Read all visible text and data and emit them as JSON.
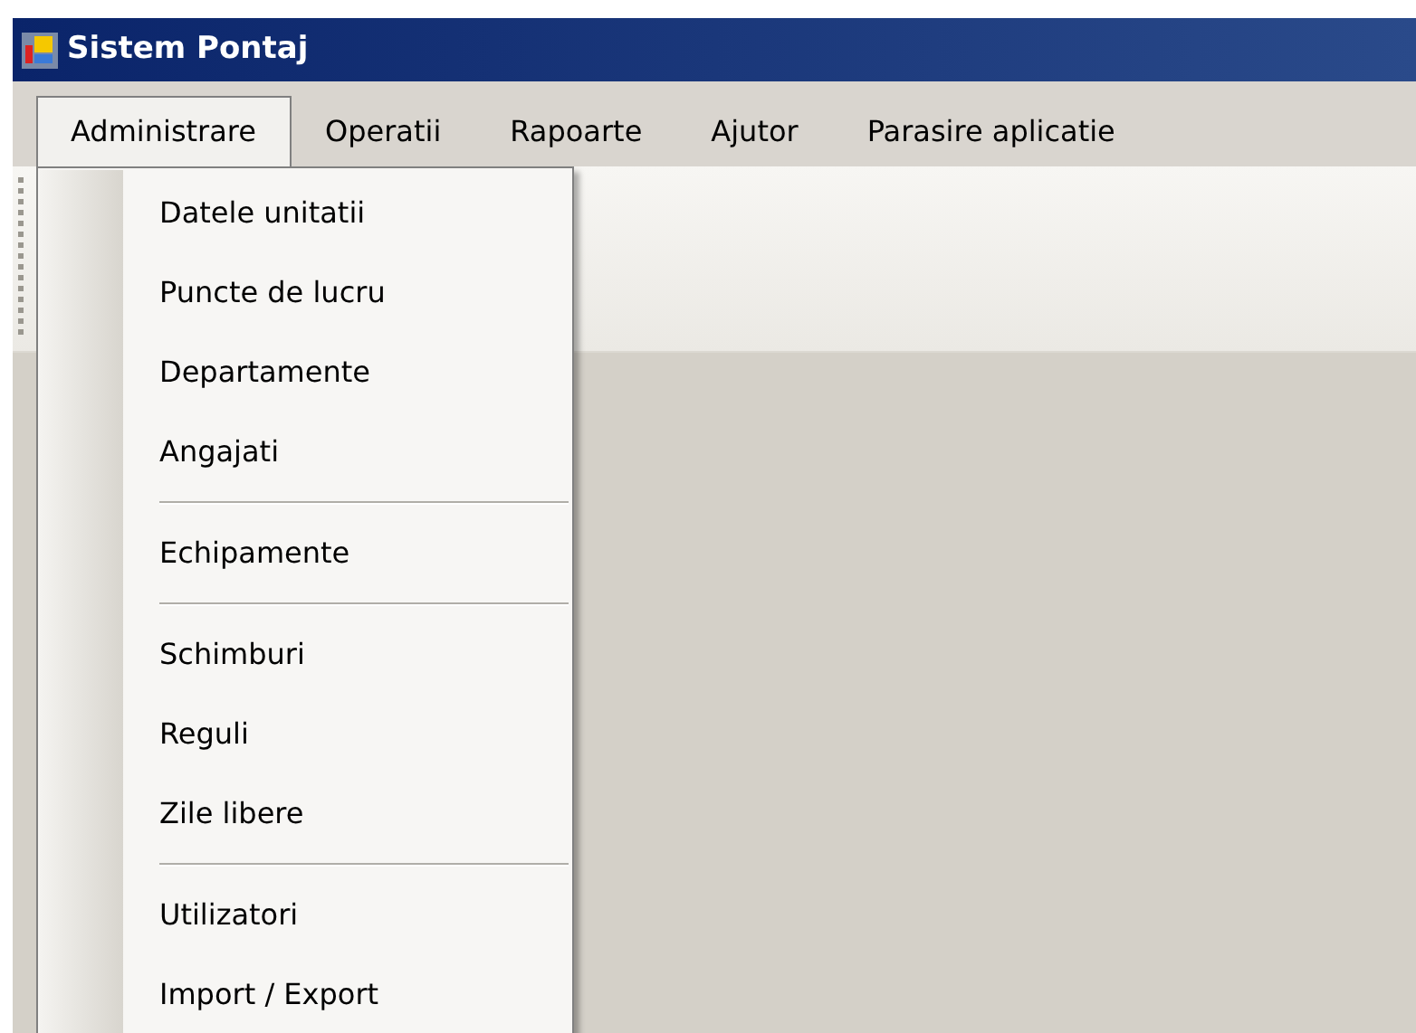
{
  "window": {
    "title": "Sistem Pontaj"
  },
  "menu_bar": [
    {
      "label": "Administrare",
      "selected": true
    },
    {
      "label": "Operatii",
      "selected": false
    },
    {
      "label": "Rapoarte",
      "selected": false
    },
    {
      "label": "Ajutor",
      "selected": false
    },
    {
      "label": "Parasire aplicatie",
      "selected": false
    }
  ],
  "dropdown": [
    {
      "kind": "item",
      "label": "Datele unitatii"
    },
    {
      "kind": "item",
      "label": "Puncte de lucru"
    },
    {
      "kind": "item",
      "label": "Departamente"
    },
    {
      "kind": "item",
      "label": "Angajati"
    },
    {
      "kind": "separator"
    },
    {
      "kind": "item",
      "label": "Echipamente"
    },
    {
      "kind": "separator"
    },
    {
      "kind": "item",
      "label": "Schimburi"
    },
    {
      "kind": "item",
      "label": "Reguli"
    },
    {
      "kind": "item",
      "label": "Zile libere"
    },
    {
      "kind": "separator"
    },
    {
      "kind": "item",
      "label": "Utilizatori"
    },
    {
      "kind": "item",
      "label": "Import / Export"
    }
  ]
}
